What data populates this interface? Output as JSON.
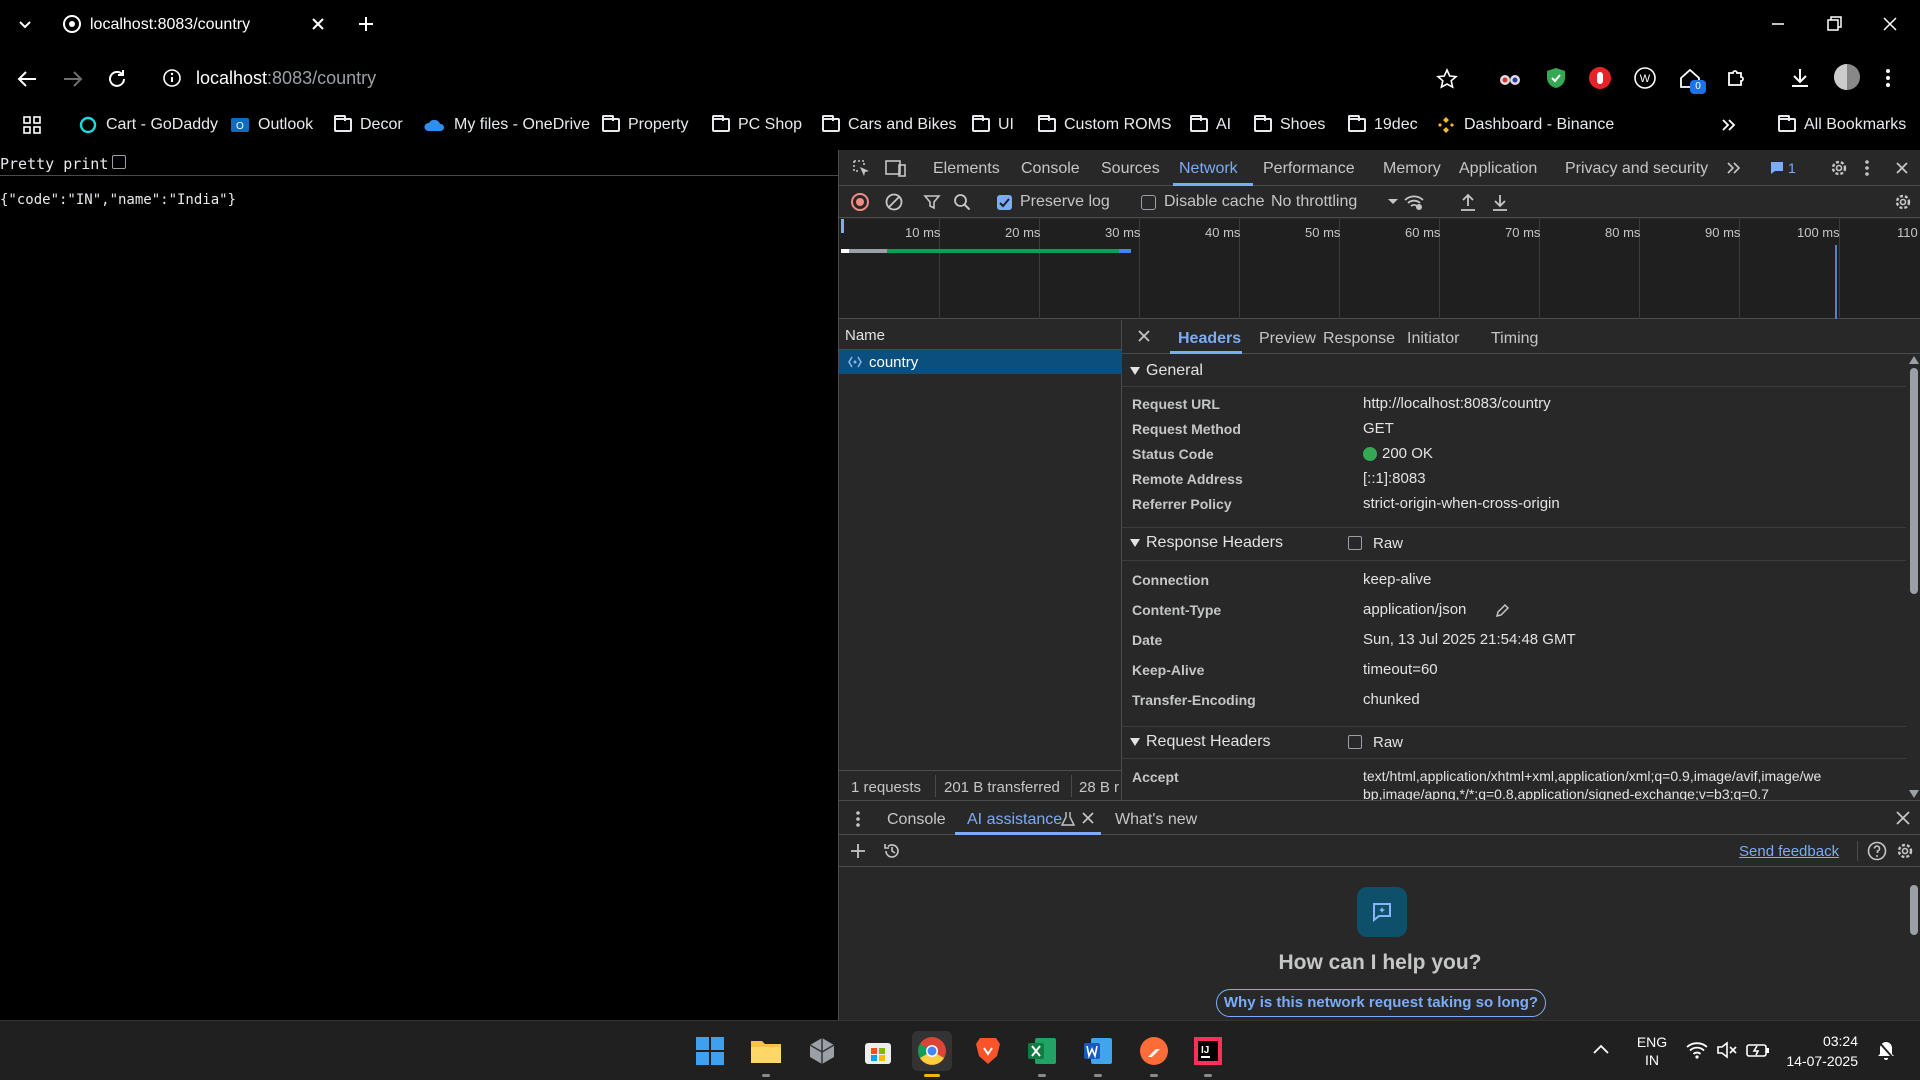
{
  "browser": {
    "tab_title": "localhost:8083/country",
    "url_host": "localhost",
    "url_path": ":8083/country",
    "extension_badge": "0"
  },
  "bookmarks": {
    "items": [
      "Cart - GoDaddy",
      "Outlook",
      "Decor",
      "My files - OneDrive",
      "Property",
      "PC Shop",
      "Cars and Bikes",
      "UI",
      "Custom ROMS",
      "AI",
      "Shoes",
      "19dec",
      "Dashboard - Binance"
    ],
    "all_label": "All Bookmarks"
  },
  "page": {
    "pretty_print_label": "Pretty print",
    "json_text": "{\"code\":\"IN\",\"name\":\"India\"}"
  },
  "devtools": {
    "tabs": [
      "Elements",
      "Console",
      "Sources",
      "Network",
      "Performance",
      "Memory",
      "Application",
      "Privacy and security"
    ],
    "active_tab": "Network",
    "issues_count": "1",
    "toolbar": {
      "preserve_log": "Preserve log",
      "disable_cache": "Disable cache",
      "throttling": "No throttling"
    },
    "timeline_ticks": [
      "10 ms",
      "20 ms",
      "30 ms",
      "40 ms",
      "50 ms",
      "60 ms",
      "70 ms",
      "80 ms",
      "90 ms",
      "100 ms",
      "110"
    ],
    "name_header": "Name",
    "request_name": "country",
    "summary": {
      "requests": "1 requests",
      "transferred": "201 B transferred",
      "resources": "28 B r"
    },
    "detail_tabs": [
      "Headers",
      "Preview",
      "Response",
      "Initiator",
      "Timing"
    ],
    "general": {
      "title": "General",
      "rows": [
        {
          "key": "Request URL",
          "value": "http://localhost:8083/country"
        },
        {
          "key": "Request Method",
          "value": "GET"
        },
        {
          "key": "Status Code",
          "value": "200 OK"
        },
        {
          "key": "Remote Address",
          "value": "[::1]:8083"
        },
        {
          "key": "Referrer Policy",
          "value": "strict-origin-when-cross-origin"
        }
      ]
    },
    "response_headers": {
      "title": "Response Headers",
      "raw": "Raw",
      "rows": [
        {
          "key": "Connection",
          "value": "keep-alive"
        },
        {
          "key": "Content-Type",
          "value": "application/json"
        },
        {
          "key": "Date",
          "value": "Sun, 13 Jul 2025 21:54:48 GMT"
        },
        {
          "key": "Keep-Alive",
          "value": "timeout=60"
        },
        {
          "key": "Transfer-Encoding",
          "value": "chunked"
        }
      ]
    },
    "request_headers": {
      "title": "Request Headers",
      "raw": "Raw",
      "accept_key": "Accept",
      "accept_line1": "text/html,application/xhtml+xml,application/xml;q=0.9,image/avif,image/we",
      "accept_line2": "bp,image/apng,*/*;q=0.8,application/signed-exchange;v=b3;q=0.7"
    },
    "drawer": {
      "tabs": [
        "Console",
        "AI assistance",
        "What's new"
      ],
      "send_feedback": "Send feedback",
      "ai_heading": "How can I help you?",
      "suggestion": "Why is this network request taking so long?"
    }
  },
  "taskbar": {
    "lang": "ENG",
    "region": "IN",
    "time": "03:24",
    "date": "14-07-2025"
  },
  "colors": {
    "accent": "#7cacf8",
    "selected_row": "#0b4f7e",
    "status_green": "#34a853"
  }
}
